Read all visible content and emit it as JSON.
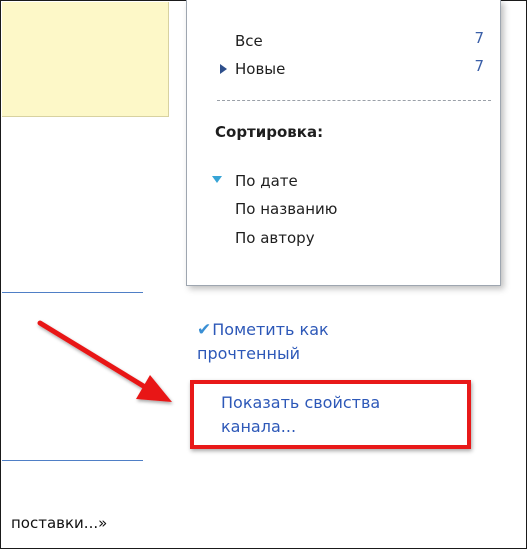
{
  "filter_menu": {
    "items": [
      {
        "label": "Все",
        "count": "7"
      },
      {
        "label": "Новые",
        "count": "7"
      }
    ],
    "sort_heading": "Сортировка:",
    "sort_options": [
      {
        "label": "По дате"
      },
      {
        "label": "По названию"
      },
      {
        "label": "По автору"
      }
    ]
  },
  "actions": {
    "mark_read_line1": "Пометить как",
    "mark_read_line2": "прочтенный",
    "show_props_line1": "Показать свойства",
    "show_props_line2": "канала..."
  },
  "feed": {
    "excerpt": "поставки...»"
  },
  "annotation": {
    "arrow_color": "#e81919",
    "box_color": "#e81919"
  }
}
